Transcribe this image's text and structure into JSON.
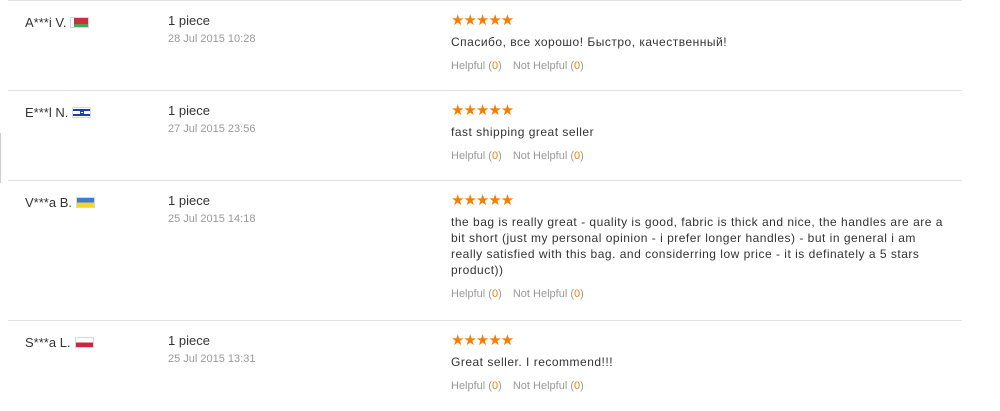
{
  "reviews": [
    {
      "buyer": "A***i V.",
      "flag": "belarus-flag-icon",
      "quantity": "1 piece",
      "date": "28 Jul 2015 10:28",
      "rating": "★★★★★",
      "text": "Спасибо, все хорошо! Быстро, качественный!",
      "helpful_label": "Helpful",
      "helpful_count": "0",
      "not_helpful_label": "Not Helpful",
      "not_helpful_count": "0"
    },
    {
      "buyer": "E***l N.",
      "flag": "israel-flag-icon",
      "quantity": "1 piece",
      "date": "27 Jul 2015 23:56",
      "rating": "★★★★★",
      "text": "fast shipping great seller",
      "helpful_label": "Helpful",
      "helpful_count": "0",
      "not_helpful_label": "Not Helpful",
      "not_helpful_count": "0"
    },
    {
      "buyer": "V***a B.",
      "flag": "ukraine-flag-icon",
      "quantity": "1 piece",
      "date": "25 Jul 2015 14:18",
      "rating": "★★★★★",
      "text": "the bag is really great - quality is good, fabric is thick and nice, the handles are are a bit short (just my personal opinion - i prefer longer handles) - but in general i am really satisfied with this bag. and considerring low price - it is definately a 5 stars product))",
      "helpful_label": "Helpful",
      "helpful_count": "0",
      "not_helpful_label": "Not Helpful",
      "not_helpful_count": "0"
    },
    {
      "buyer": "S***a L.",
      "flag": "poland-flag-icon",
      "quantity": "1 piece",
      "date": "25 Jul 2015 13:31",
      "rating": "★★★★★",
      "text": "Great seller. I recommend!!!",
      "helpful_label": "Helpful",
      "helpful_count": "0",
      "not_helpful_label": "Not Helpful",
      "not_helpful_count": "0"
    }
  ],
  "accent_color": "#f57e00"
}
